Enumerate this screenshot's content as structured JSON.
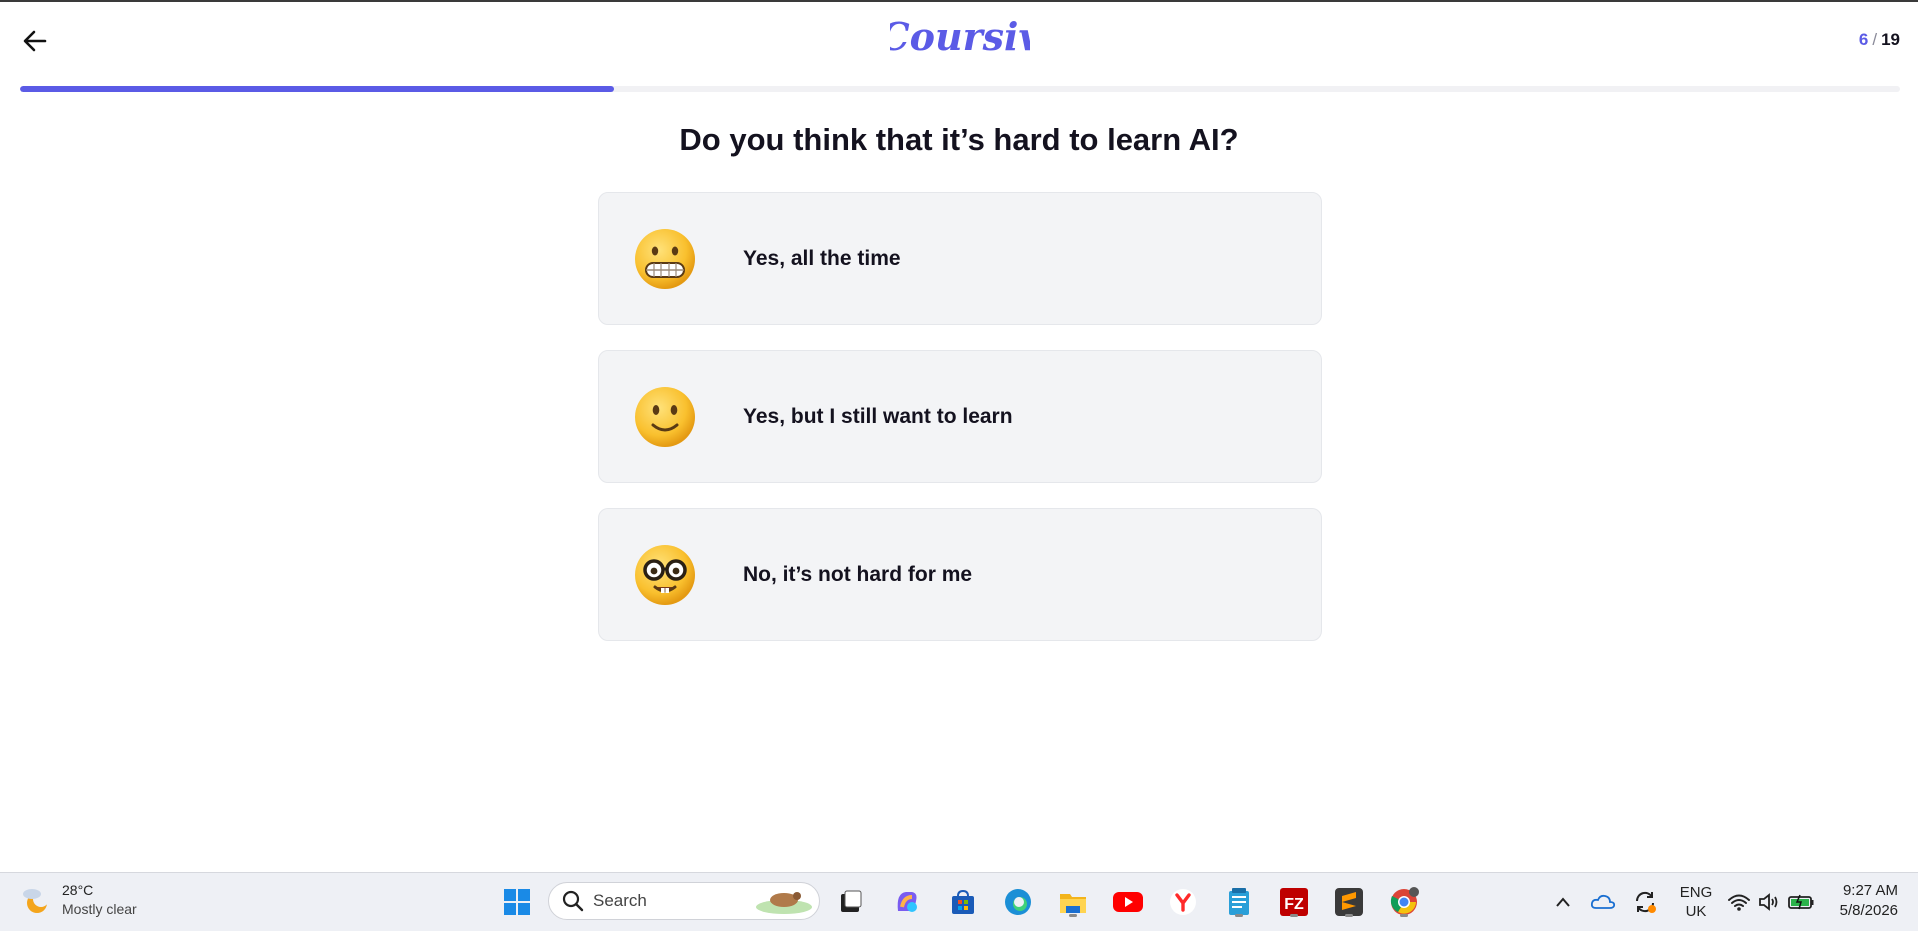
{
  "header": {
    "logo_text": "Coursiv",
    "step_current": "6",
    "step_separator": "/",
    "step_total": "19",
    "progress_fraction": 0.3158
  },
  "question": "Do you think that it’s hard to learn AI?",
  "options": [
    {
      "label": "Yes, all the time",
      "icon": "grimacing-face-icon"
    },
    {
      "label": "Yes, but I still want to learn",
      "icon": "slightly-smiling-face-icon"
    },
    {
      "label": "No, it’s not hard for me",
      "icon": "nerd-face-icon"
    }
  ],
  "colors": {
    "accent": "#5b5be6",
    "option_bg": "#f3f4f6",
    "text": "#14121f"
  },
  "taskbar": {
    "weather": {
      "temp": "28°C",
      "condition": "Mostly clear",
      "icon": "moon-cloud-icon"
    },
    "search_placeholder": "Search",
    "apps": [
      "windows-start-icon",
      "task-view-icon",
      "copilot-icon",
      "store-icon",
      "edge-icon",
      "file-explorer-icon",
      "youtube-icon",
      "yandex-icon",
      "notepad-icon",
      "filezilla-icon",
      "sublime-text-icon",
      "chrome-icon"
    ],
    "tray": {
      "lang_top": "ENG",
      "lang_bottom": "UK"
    },
    "clock": {
      "time": "9:27 AM",
      "date": "5/8/2026"
    }
  }
}
